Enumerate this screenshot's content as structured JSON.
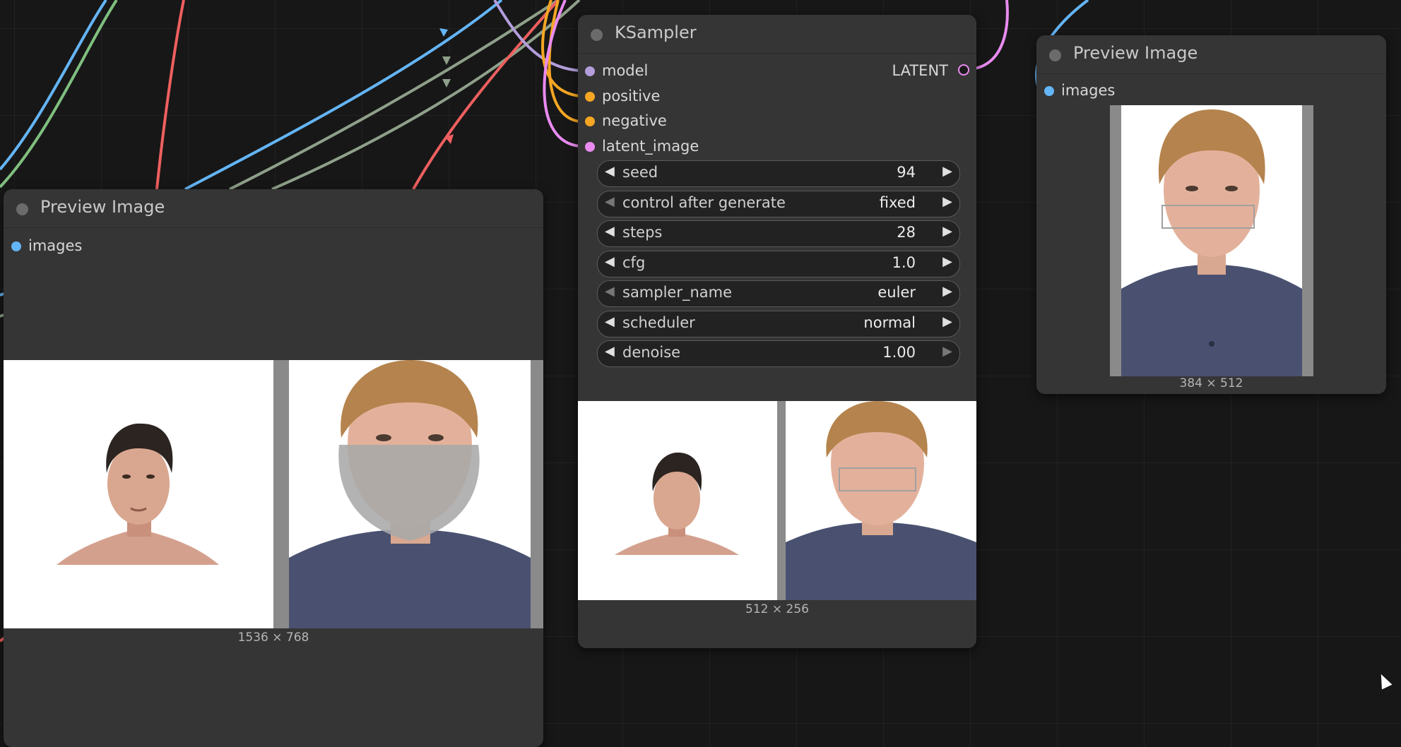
{
  "colors": {
    "model": "#b39ddb",
    "conditioning": "#f5a623",
    "latent": "#e98bf0",
    "image": "#64b5f6",
    "wire_green": "#7fbf7f",
    "wire_gray": "#8fa08a",
    "wire_red": "#ef5f5f"
  },
  "nodes": {
    "preview_left": {
      "title": "Preview Image",
      "input_label": "images",
      "caption": "1536 × 768"
    },
    "ksampler": {
      "title": "KSampler",
      "inputs": [
        "model",
        "positive",
        "negative",
        "latent_image"
      ],
      "output_label": "LATENT",
      "widgets": [
        {
          "name": "seed",
          "value": "94"
        },
        {
          "name": "control after generate",
          "value": "fixed"
        },
        {
          "name": "steps",
          "value": "28"
        },
        {
          "name": "cfg",
          "value": "1.0"
        },
        {
          "name": "sampler_name",
          "value": "euler"
        },
        {
          "name": "scheduler",
          "value": "normal"
        },
        {
          "name": "denoise",
          "value": "1.00"
        }
      ],
      "caption": "512 × 256"
    },
    "preview_right": {
      "title": "Preview Image",
      "input_label": "images",
      "caption": "384 × 512"
    }
  }
}
